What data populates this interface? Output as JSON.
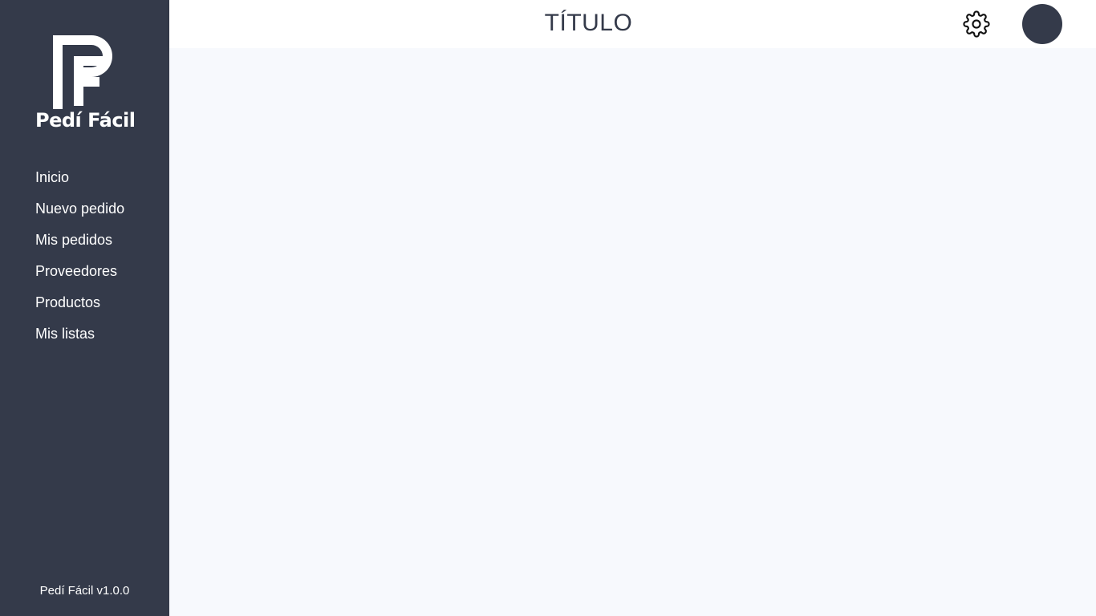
{
  "brand": {
    "name": "Pedí Fácil",
    "version_label": "Pedí Fácil v1.0.0"
  },
  "header": {
    "title": "TÍTULO",
    "settings_icon": "gear-icon"
  },
  "sidebar": {
    "items": [
      {
        "label": "Inicio"
      },
      {
        "label": "Nuevo pedido"
      },
      {
        "label": "Mis pedidos"
      },
      {
        "label": "Proveedores"
      },
      {
        "label": "Productos"
      },
      {
        "label": "Mis listas"
      }
    ]
  },
  "colors": {
    "sidebar_bg": "#343a4a",
    "content_bg": "#f7f9fd",
    "header_bg": "#ffffff",
    "text_dark": "#343a4a"
  }
}
